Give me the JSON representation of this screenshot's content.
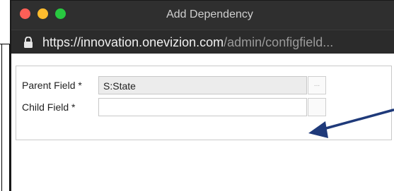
{
  "window": {
    "title": "Add Dependency",
    "url_host": "https://innovation.onevizion.com",
    "url_path": "/admin/configfield..."
  },
  "form": {
    "parent_label": "Parent Field *",
    "parent_value": "S:State",
    "parent_picker": "...",
    "child_label": "Child Field *",
    "child_value": "",
    "child_picker": ""
  },
  "icons": {
    "lock": "lock-icon",
    "arrow": "arrow-annotation"
  },
  "colors": {
    "titlebar": "#2f2f2f",
    "arrow": "#1f3a7a",
    "traffic_red": "#fe5f57",
    "traffic_yellow": "#febc2e",
    "traffic_green": "#28c840"
  }
}
